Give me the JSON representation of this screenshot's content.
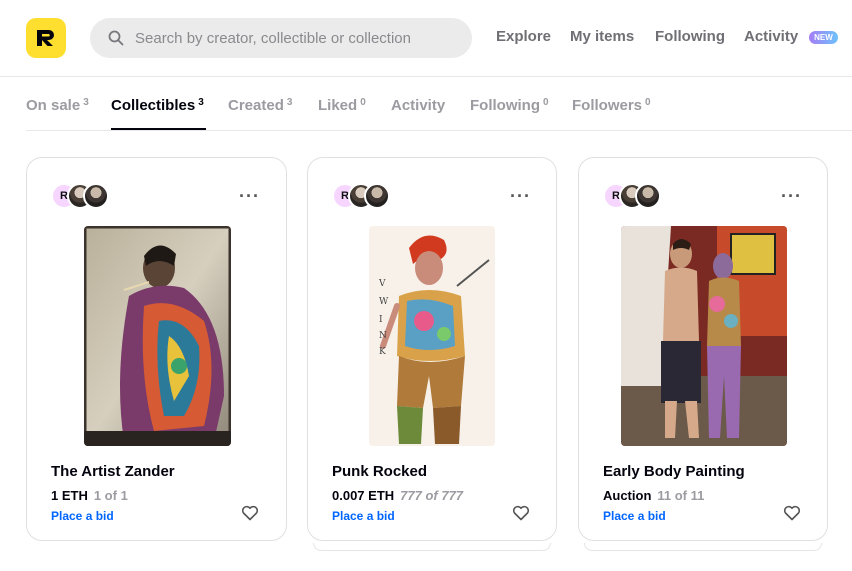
{
  "header": {
    "logo_letter": "R",
    "search_placeholder": "Search by creator, collectible or collection",
    "nav": [
      "Explore",
      "My items",
      "Following",
      "Activity"
    ],
    "activity_badge": "NEW"
  },
  "tabs": [
    {
      "label": "On sale",
      "count": "3"
    },
    {
      "label": "Collectibles",
      "count": "3"
    },
    {
      "label": "Created",
      "count": "3"
    },
    {
      "label": "Liked",
      "count": "0"
    },
    {
      "label": "Activity",
      "count": ""
    },
    {
      "label": "Following",
      "count": "0"
    },
    {
      "label": "Followers",
      "count": "0"
    }
  ],
  "active_tab": "Collectibles",
  "cards": [
    {
      "title": "The Artist Zander",
      "price": "1 ETH",
      "edition": "1 of 1",
      "action": "Place a bid",
      "avatar_letter": "R"
    },
    {
      "title": "Punk Rocked",
      "price": "0.007 ETH",
      "edition": "777 of 777",
      "action": "Place a bid",
      "avatar_letter": "R"
    },
    {
      "title": "Early Body Painting",
      "price": "Auction",
      "edition": "11 of 11",
      "action": "Place a bid",
      "avatar_letter": "R"
    }
  ],
  "colors": {
    "brand_yellow": "#fedf30",
    "link_blue": "#0066ff",
    "text_dark": "#04040f",
    "muted": "#9b9ba1"
  },
  "icons": [
    "search-icon",
    "more-icon",
    "heart-icon"
  ]
}
